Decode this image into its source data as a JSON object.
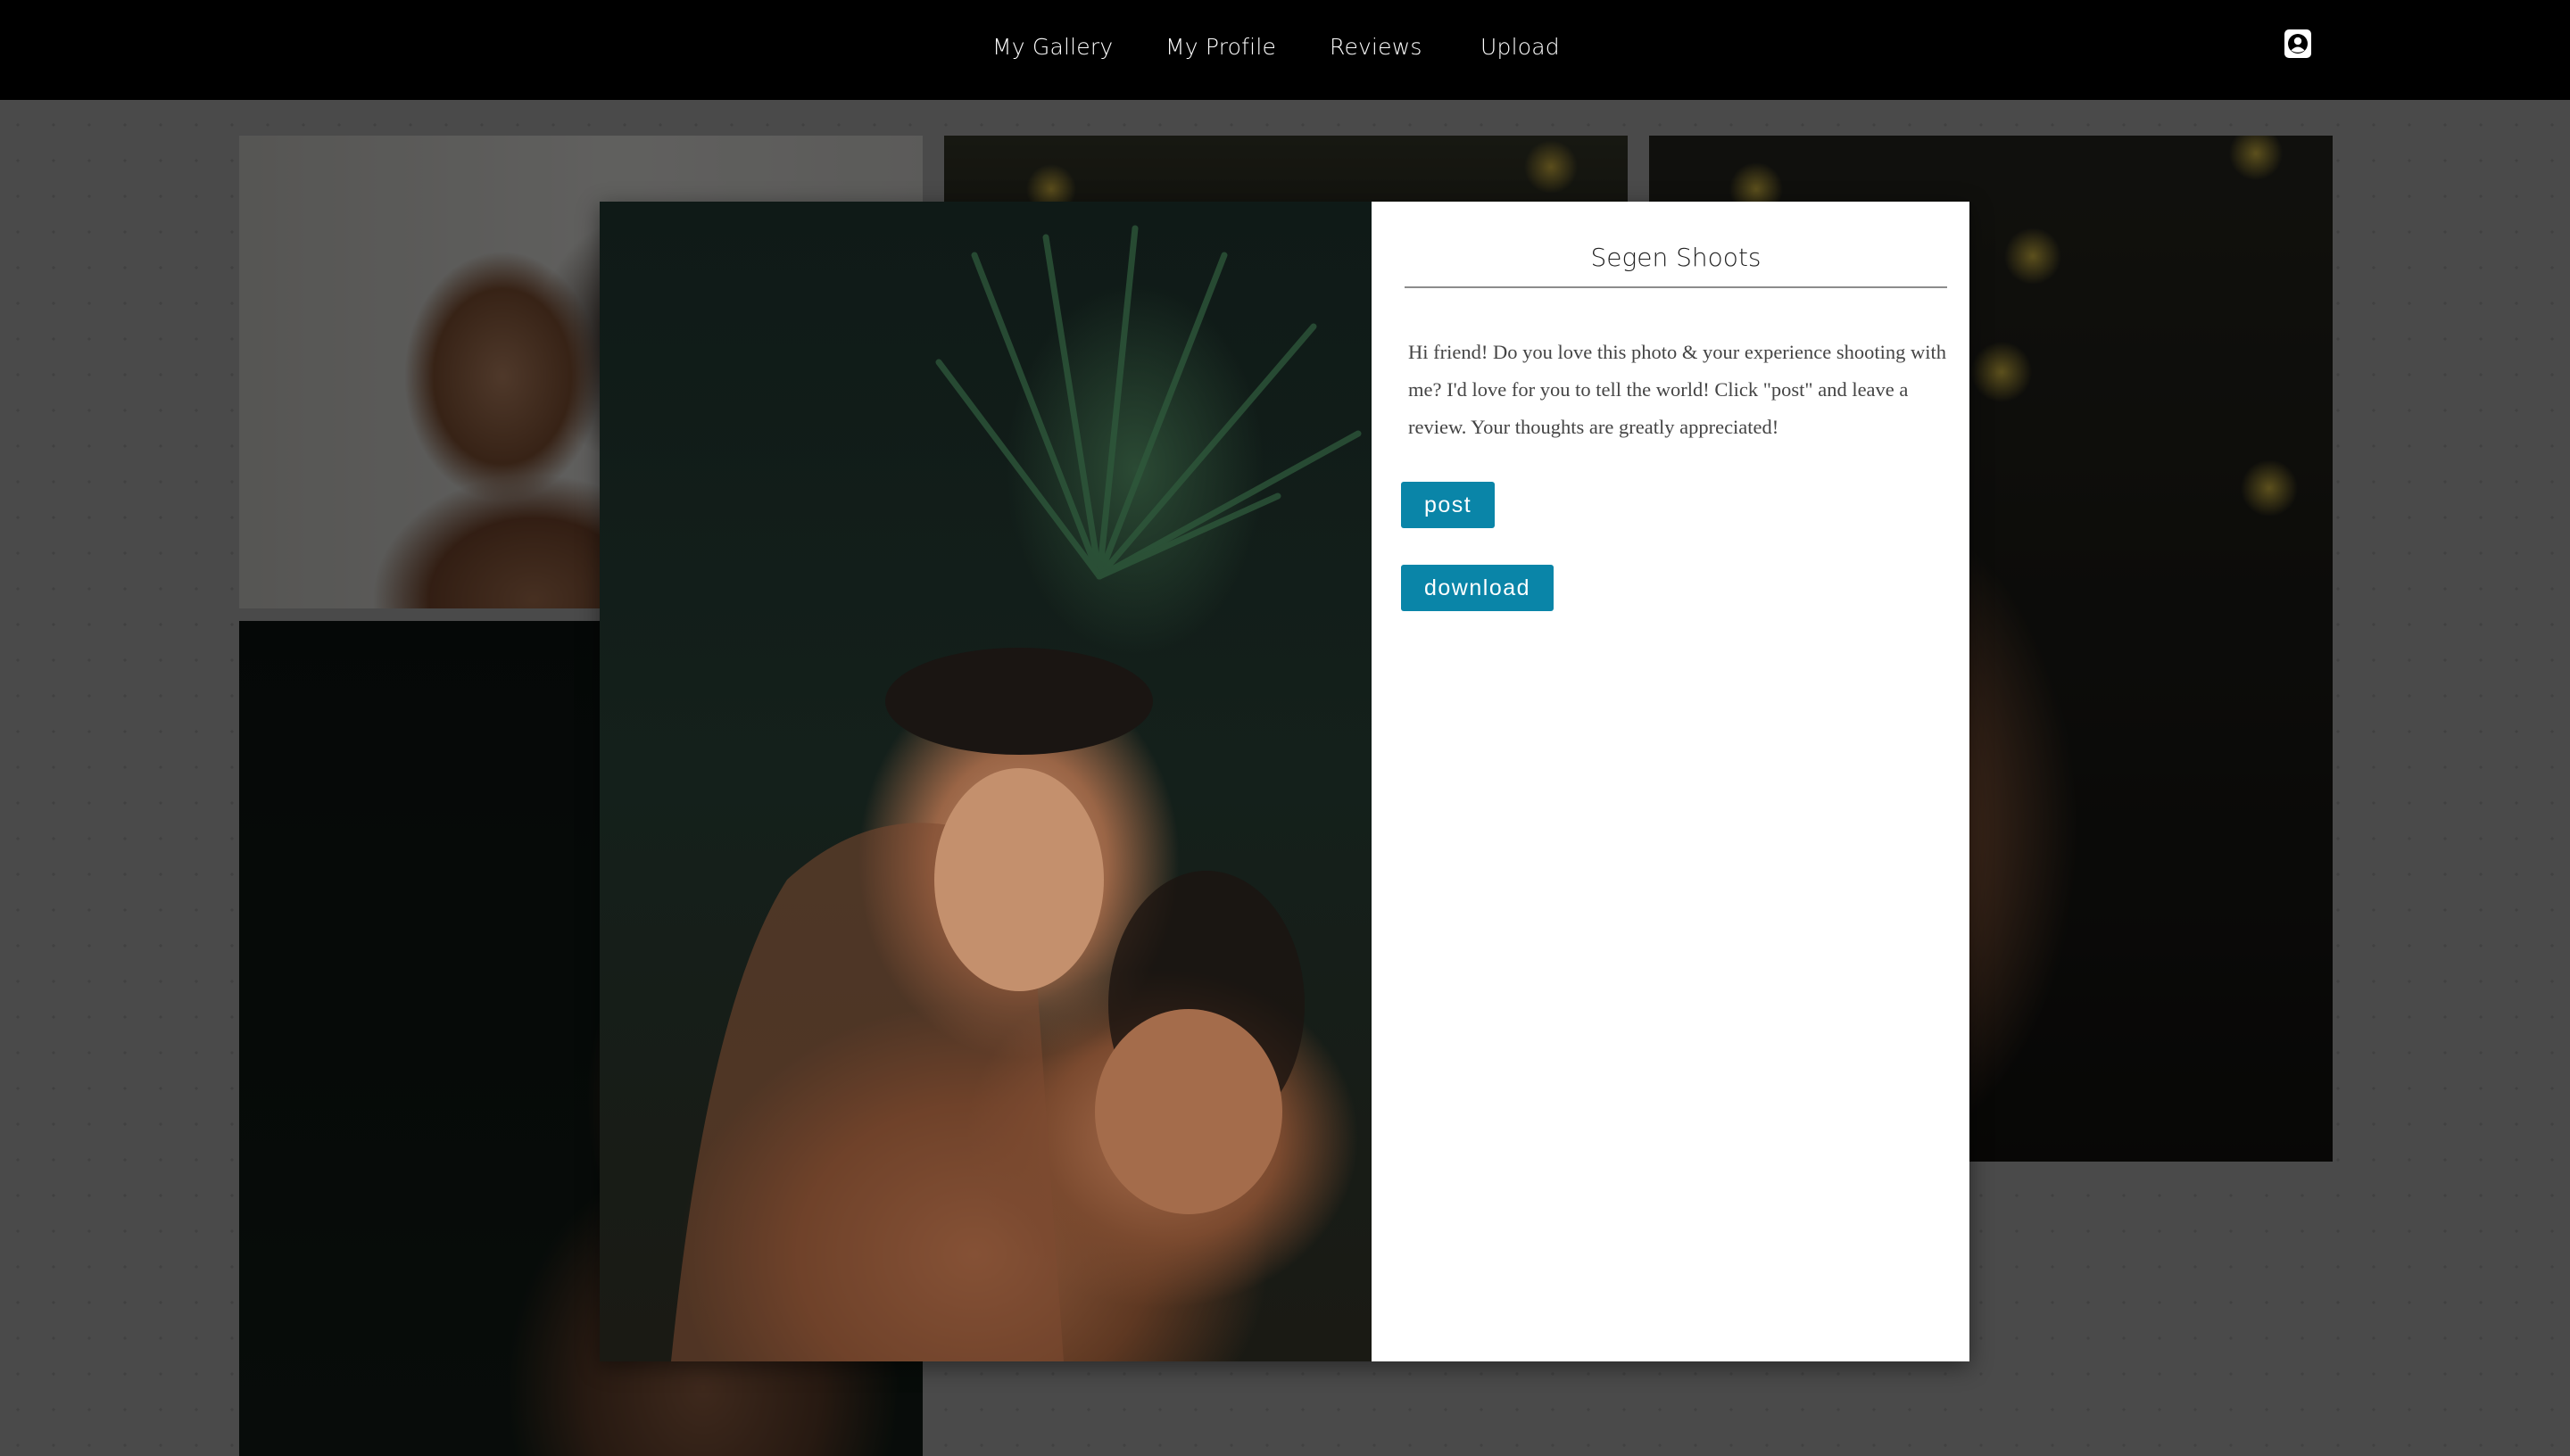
{
  "nav": {
    "items": [
      "My Gallery",
      "My Profile",
      "Reviews",
      "Upload"
    ]
  },
  "modal": {
    "title": "Segen Shoots",
    "message": "Hi friend! Do you love this photo & your experience shooting with me? I'd love for you to tell the world! Click \"post\" and leave a review. Your thoughts are greatly appreciated!",
    "post_label": "post",
    "download_label": "download"
  },
  "colors": {
    "topbar": "#000000",
    "button": "#0a85a8",
    "panel": "#ffffff"
  },
  "icons": {
    "profile": "user-circle-icon"
  }
}
